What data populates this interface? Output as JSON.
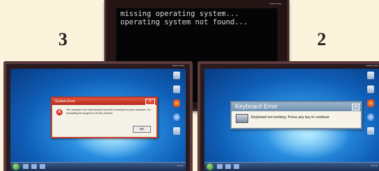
{
  "labels": {
    "left_number": "3",
    "right_number": "2"
  },
  "top_monitor": {
    "lines": [
      "missing operating system...",
      "operating system not found..."
    ]
  },
  "left_monitor": {
    "dialog_title": "System Error",
    "dialog_message": "The computer can't start because boot.dll is missing from your computer. Try reinstalling the program to fix this problem.",
    "ok_label": "OK"
  },
  "right_monitor": {
    "dialog_title": "Keyboard Error",
    "dialog_message": "Keyboard not working. Press any key to continue"
  },
  "colors": {
    "background": "#fbf3dc",
    "error_red": "#d8261c",
    "desktop_blue": "#1f78d0"
  }
}
